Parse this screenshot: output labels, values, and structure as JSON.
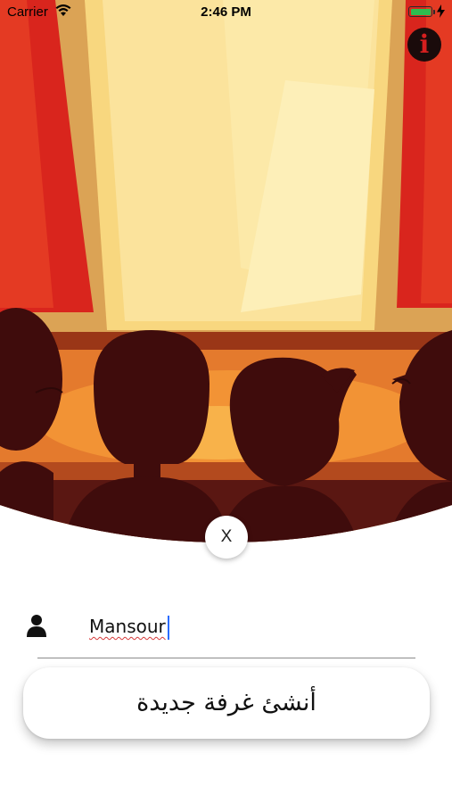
{
  "status_bar": {
    "carrier": "Carrier",
    "time": "2:46 PM",
    "battery_level": 1.0
  },
  "header": {
    "info_label": "i"
  },
  "close": {
    "label": "X"
  },
  "form": {
    "name_value": "Mansour"
  },
  "actions": {
    "create_room_label": "أنشئ غرفة جديدة"
  },
  "colors": {
    "curtain": "#d9251d",
    "stage_light": "#fbe9a0",
    "silhouette": "#3f0c0c",
    "info_badge": "#1a0b0b",
    "info_letter": "#d61f1f",
    "caret": "#2b6cff"
  },
  "icons": [
    "wifi-icon",
    "battery-icon",
    "bolt-icon",
    "info-icon",
    "close-icon",
    "user-icon"
  ]
}
